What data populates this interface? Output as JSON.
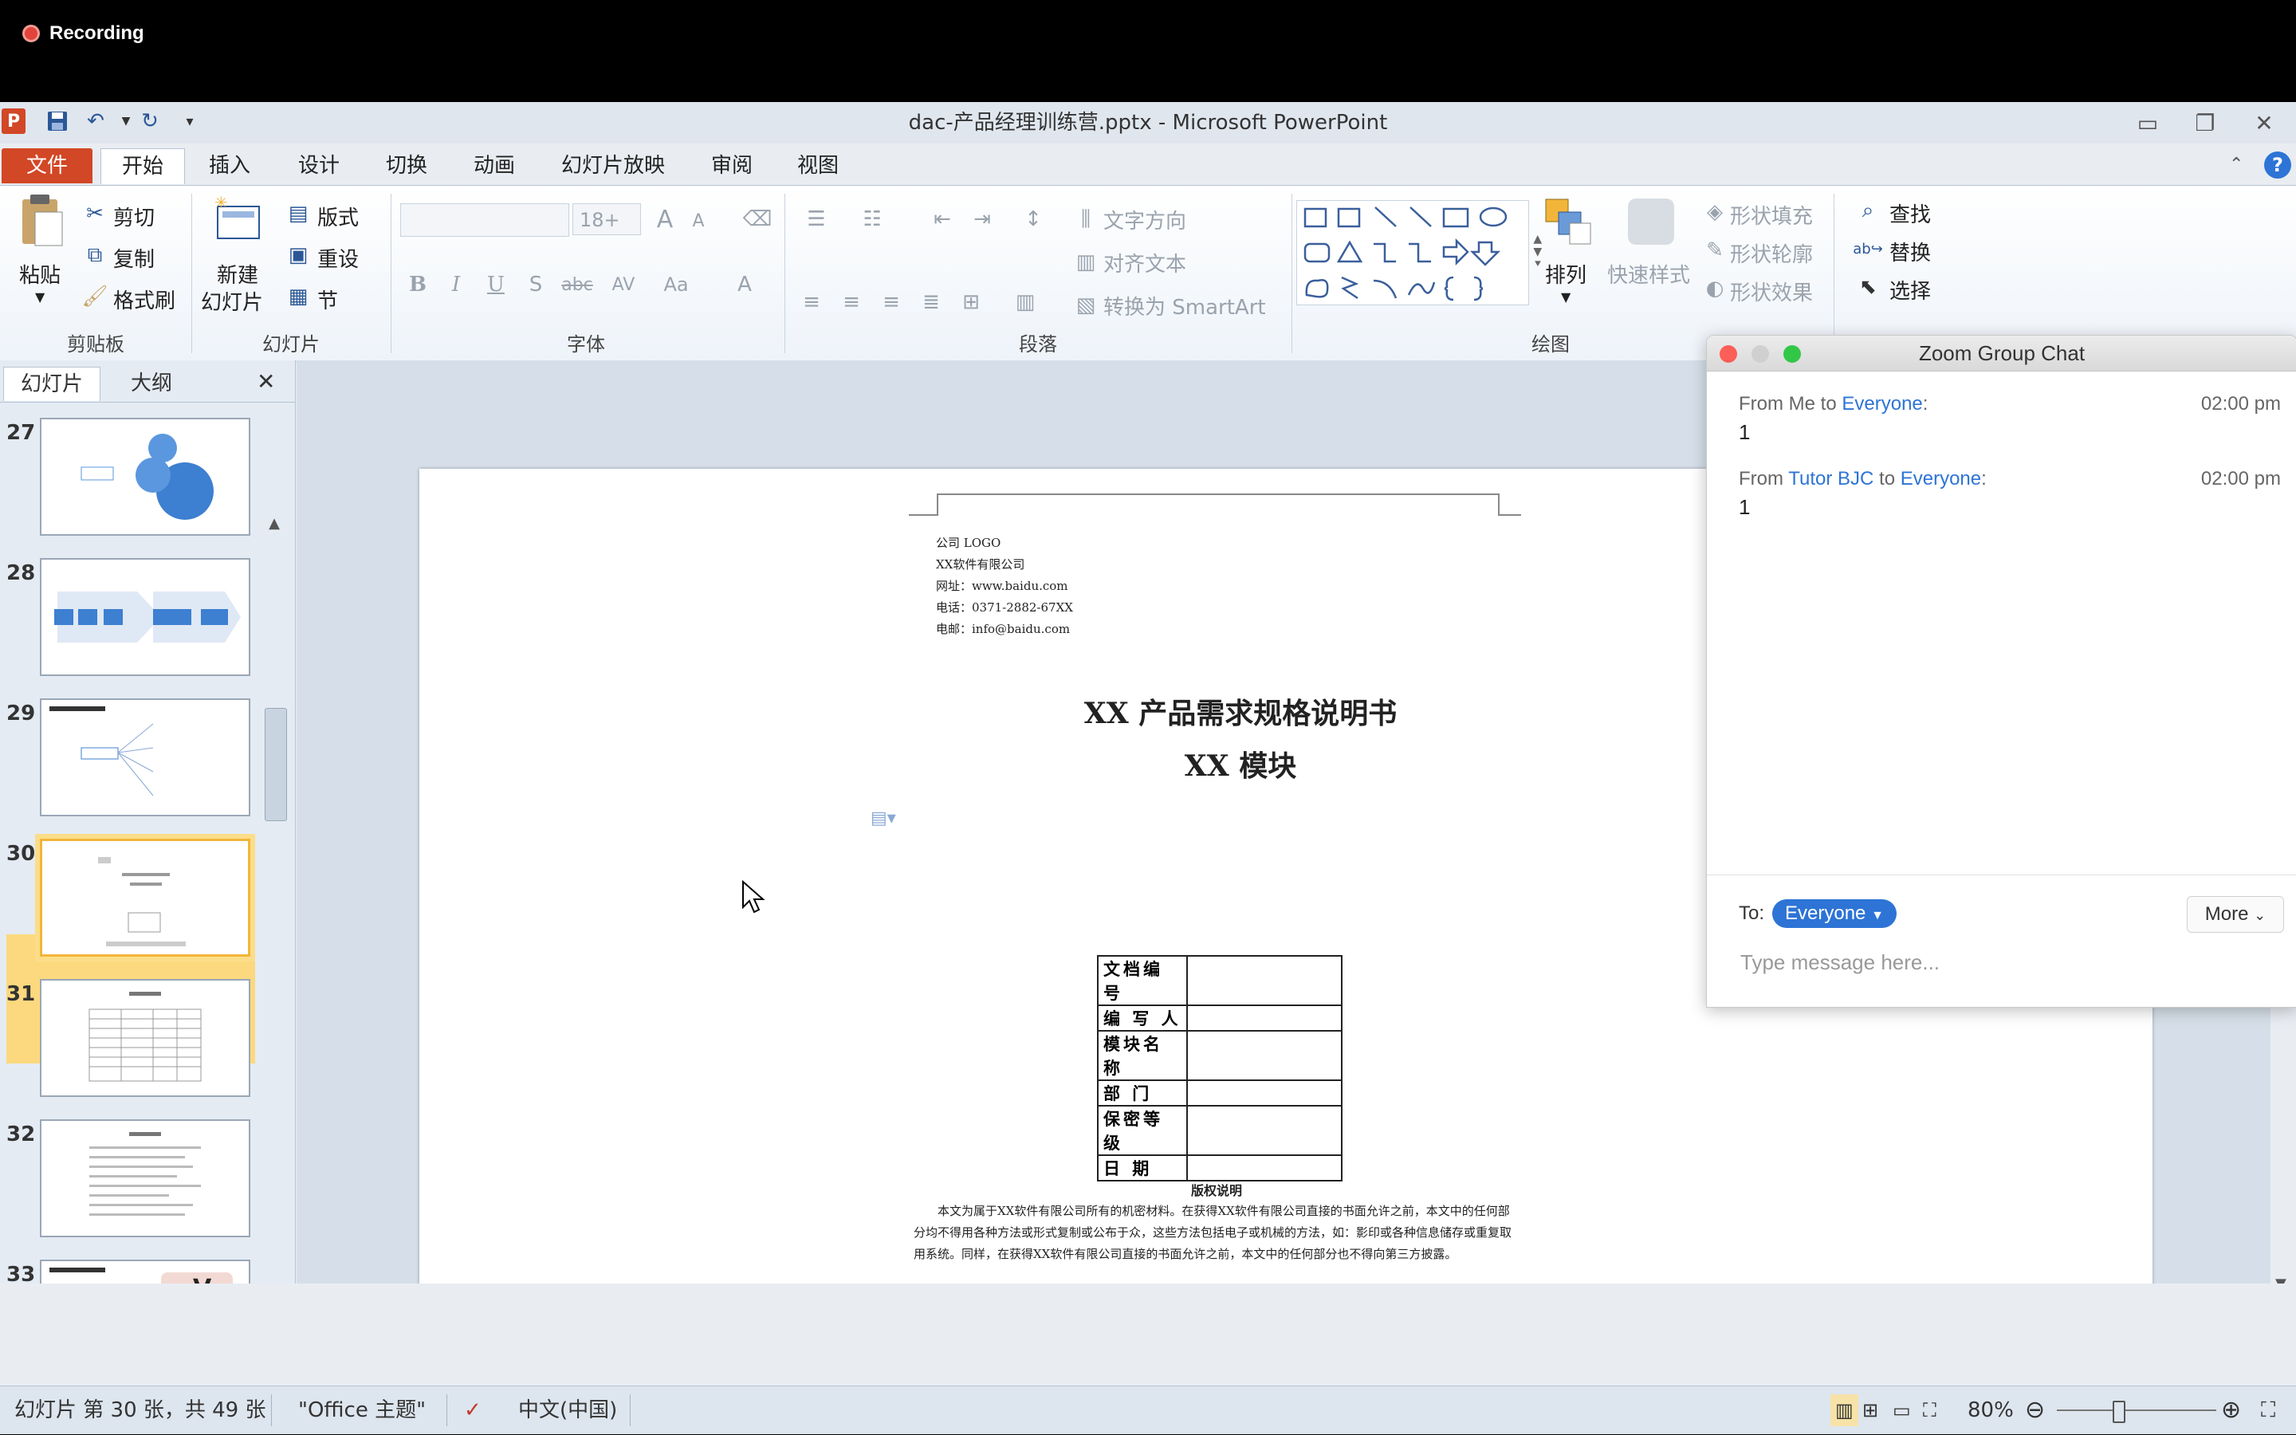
{
  "recording": {
    "label": "Recording"
  },
  "window": {
    "title": "dac-产品经理训练营.pptx - Microsoft PowerPoint",
    "app_letter": "P"
  },
  "tabs": [
    "文件",
    "开始",
    "插入",
    "设计",
    "切换",
    "动画",
    "幻灯片放映",
    "审阅",
    "视图"
  ],
  "ribbon": {
    "clipboard": {
      "paste": "粘贴",
      "cut": "剪切",
      "copy": "复制",
      "format_painter": "格式刷",
      "group": "剪贴板"
    },
    "slides": {
      "new_line1": "新建",
      "new_line2": "幻灯片",
      "layout": "版式",
      "reset": "重设",
      "section": "节",
      "group": "幻灯片"
    },
    "font": {
      "size": "18+",
      "group": "字体"
    },
    "paragraph": {
      "text_direction": "文字方向",
      "align_text": "对齐文本",
      "smartart": "转换为 SmartArt",
      "group": "段落"
    },
    "drawing": {
      "arrange": "排列",
      "quick_styles": "快速样式",
      "shape_fill": "形状填充",
      "shape_outline": "形状轮廓",
      "shape_effects": "形状效果",
      "group": "绘图"
    },
    "editing": {
      "find": "查找",
      "replace": "替换",
      "select": "选择"
    }
  },
  "left_pane": {
    "tab_slides": "幻灯片",
    "tab_outline": "大纲",
    "slide_numbers": [
      "27",
      "28",
      "29",
      "30",
      "31",
      "32",
      "33"
    ]
  },
  "slide": {
    "company_lines": [
      "公司 LOGO",
      "XX软件有限公司",
      "网址：www.baidu.com",
      "电话：0371-2882-67XX",
      "电邮：info@baidu.com"
    ],
    "title1": "XX 产品需求规格说明书",
    "title2": "XX 模块",
    "table_rows": [
      "文档编号",
      "编 写 人",
      "模块名称",
      "部 门",
      "保密等级",
      "日 期"
    ],
    "copyright_title": "版权说明",
    "copyright_text": "本文为属于XX软件有限公司所有的机密材料。在获得XX软件有限公司直接的书面允许之前，本文中的任何部分均不得用各种方法或形式复制或公布于众，这些方法包括电子或机械的方法，如：影印或各种信息储存或重复取用系统。同样，在获得XX软件有限公司直接的书面允许之前，本文中的任何部分也不得向第三方披露。"
  },
  "status": {
    "slide_info": "幻灯片 第 30 张，共 49 张",
    "theme": "\"Office 主题\"",
    "language": "中文(中国)",
    "zoom": "80%"
  },
  "chat": {
    "title": "Zoom Group Chat",
    "messages": [
      {
        "from_prefix": "From ",
        "sender": "Me",
        "to_word": " to ",
        "recipient": "Everyone",
        "colon": ":",
        "time": "02:00 pm",
        "body": "1"
      },
      {
        "from_prefix": "From ",
        "sender": "Tutor BJC",
        "to_word": " to ",
        "recipient": "Everyone",
        "colon": ":",
        "time": "02:00 pm",
        "body": "1"
      }
    ],
    "to_label": "To:",
    "to_value": "Everyone",
    "more": "More",
    "placeholder": "Type message here..."
  },
  "colors": {
    "file_tab": "#d24726",
    "zoom_blue": "#2d74d6",
    "selected_slide": "#fcd97e"
  }
}
